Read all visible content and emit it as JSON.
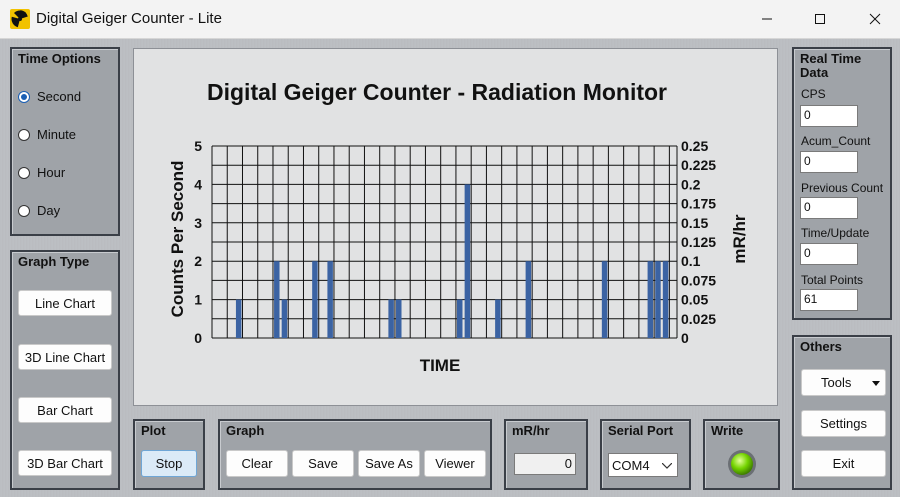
{
  "window": {
    "title": "Digital Geiger Counter - Lite"
  },
  "time_options": {
    "title": "Time Options",
    "options": [
      "Second",
      "Minute",
      "Hour",
      "Day"
    ],
    "selected": "Second"
  },
  "graph_type": {
    "title": "Graph Type",
    "buttons": [
      "Line Chart",
      "3D Line Chart",
      "Bar Chart",
      "3D Bar Chart"
    ]
  },
  "real_time": {
    "title": "Real Time Data",
    "fields": [
      {
        "label": "CPS",
        "value": "0"
      },
      {
        "label": "Acum_Count",
        "value": "0"
      },
      {
        "label": "Previous Count",
        "value": "0"
      },
      {
        "label": "Time/Update",
        "value": "0"
      },
      {
        "label": "Total Points",
        "value": "61"
      }
    ]
  },
  "others": {
    "title": "Others",
    "tools_label": "Tools",
    "settings_label": "Settings",
    "exit_label": "Exit"
  },
  "plot": {
    "title": "Plot",
    "stop_label": "Stop"
  },
  "graph": {
    "title": "Graph",
    "buttons": [
      "Clear",
      "Save",
      "Save As",
      "Viewer"
    ]
  },
  "mrhr": {
    "title": "mR/hr",
    "value": "0"
  },
  "serial": {
    "title": "Serial Port",
    "value": "COM4"
  },
  "write": {
    "title": "Write",
    "led_color": "#74d400"
  },
  "chart_data": {
    "type": "bar",
    "title": "Digital Geiger Counter - Radiation Monitor",
    "xlabel": "TIME",
    "ylabel": "Counts Per Second",
    "y2label": "mR/hr",
    "ylim": [
      0,
      5
    ],
    "y2lim": [
      0,
      0.25
    ],
    "yticks": [
      "0",
      "1",
      "2",
      "3",
      "4",
      "5"
    ],
    "y2ticks": [
      "0",
      "0.025",
      "0.05",
      "0.075",
      "0.1",
      "0.125",
      "0.15",
      "0.175",
      "0.2",
      "0.225",
      "0.25"
    ],
    "grid": true,
    "bar_color": "#3b63a3",
    "x": [
      1,
      2,
      3,
      4,
      5,
      6,
      7,
      8,
      9,
      10,
      11,
      12,
      13,
      14,
      15,
      16,
      17,
      18,
      19,
      20,
      21,
      22,
      23,
      24,
      25,
      26,
      27,
      28,
      29,
      30,
      31,
      32,
      33,
      34,
      35,
      36,
      37,
      38,
      39,
      40,
      41,
      42,
      43,
      44,
      45,
      46,
      47,
      48,
      49,
      50,
      51,
      52,
      53,
      54,
      55,
      56,
      57,
      58,
      59,
      60,
      61
    ],
    "values": [
      0,
      0,
      0,
      1,
      0,
      0,
      0,
      0,
      2,
      1,
      0,
      0,
      0,
      2,
      0,
      2,
      0,
      0,
      0,
      0,
      0,
      0,
      0,
      1,
      1,
      0,
      0,
      0,
      0,
      0,
      0,
      0,
      1,
      4,
      0,
      0,
      0,
      1,
      0,
      0,
      0,
      2,
      0,
      0,
      0,
      0,
      0,
      0,
      0,
      0,
      0,
      2,
      0,
      0,
      0,
      0,
      0,
      2,
      2,
      2,
      0
    ]
  }
}
